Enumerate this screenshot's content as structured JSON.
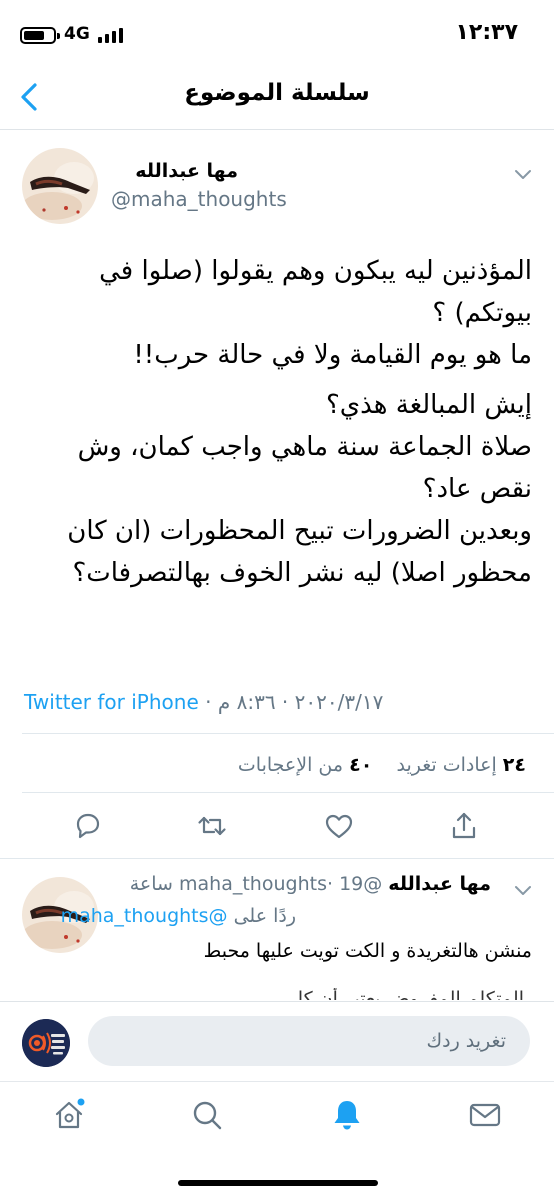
{
  "status_bar": {
    "time": "١٢:٣٧",
    "network": "4G"
  },
  "nav": {
    "title": "سلسلة الموضوع"
  },
  "tweet": {
    "author_name": "مها عبدالله",
    "author_handle": "@maha_thoughts",
    "lines": [
      "المؤذنين ليه يبكون وهم يقولوا (صلوا في بيوتكم) ؟",
      "ما هو يوم القيامة ولا في حالة حرب!!",
      "إيش المبالغة هذي؟",
      "صلاة الجماعة سنة ماهي واجب كمان، وش نقص عاد؟",
      "وبعدين الضرورات تبيح المحظورات (ان كان محظور اصلا) ليه نشر الخوف بهالتصرفات؟"
    ],
    "source": "Twitter for iPhone",
    "separator": "·",
    "date": "٢٠٢٠/٣/١٧",
    "time": "٨:٣٦ م",
    "retweets_count": "٢٤",
    "retweets_label": "إعادات تغريد",
    "likes_count": "٤٠",
    "likes_label": "من الإعجابات"
  },
  "reply": {
    "author_name": "مها عبدالله",
    "author_handle": "@maha_thoughts",
    "time_ago": "19 ساعة",
    "separator": "·",
    "replying_label": "ردًا على",
    "replying_handle": "@maha_thoughts",
    "text": "منشن هالتغريدة و الكت تويت عليها محبط",
    "peek_text": "المتكلم المفروض يعتبر أن كل"
  },
  "composer": {
    "placeholder": "تغريد ردك"
  },
  "colors": {
    "accent": "#1da1f2",
    "secondary_text": "#657786"
  },
  "icons": {
    "nav": "chevron-left-icon",
    "actions": [
      "reply-icon",
      "retweet-icon",
      "like-icon",
      "share-icon"
    ],
    "tabs": [
      "home-icon",
      "search-icon",
      "notifications-icon",
      "messages-icon"
    ]
  }
}
